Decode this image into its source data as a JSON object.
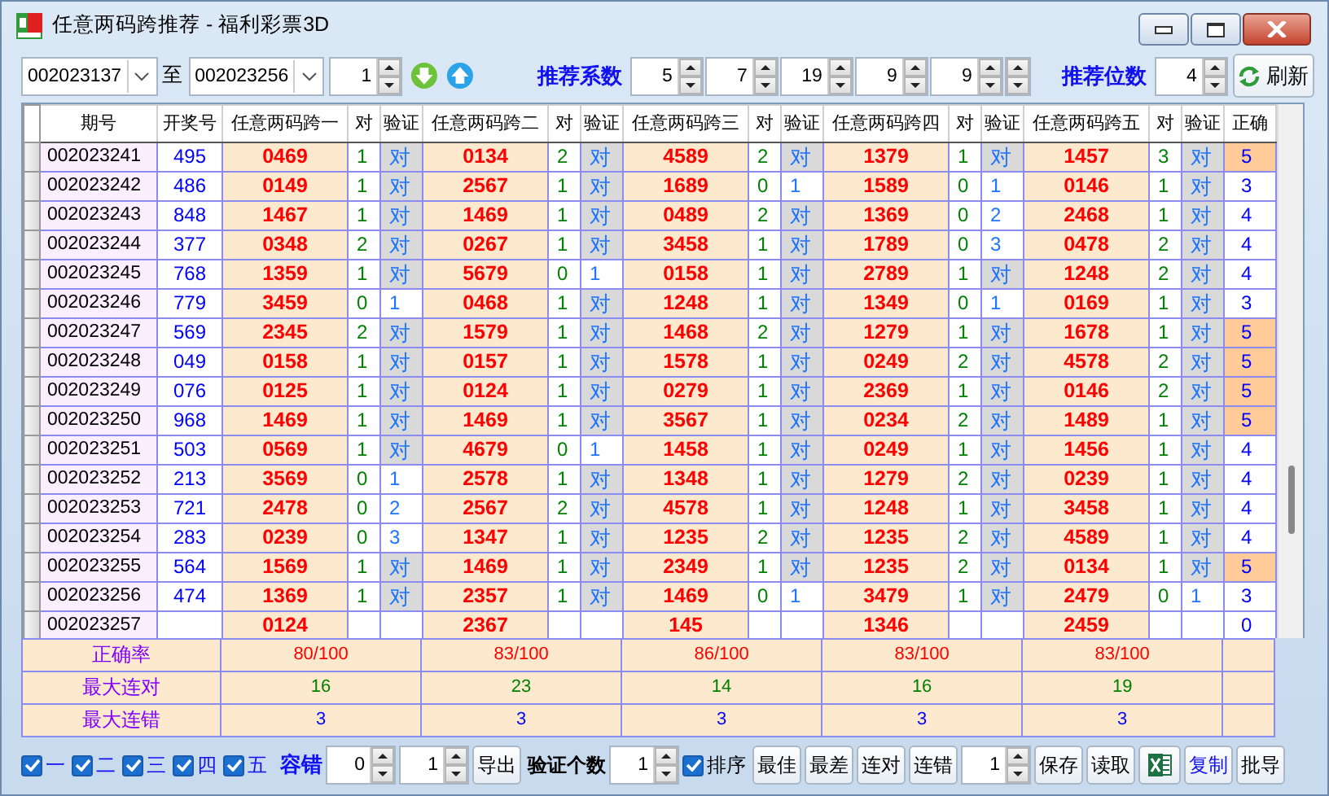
{
  "window": {
    "title": "任意两码跨推荐 - 福利彩票3D"
  },
  "toolbar": {
    "from_period": "002023137",
    "to_label": "至",
    "to_period": "002023256",
    "step": "1",
    "coef_label": "推荐系数",
    "coefs": [
      "5",
      "7",
      "19",
      "9",
      "9"
    ],
    "digits_label": "推荐位数",
    "digits": "4",
    "refresh": "刷新"
  },
  "table": {
    "columns": [
      "期号",
      "开奖号",
      "任意两码跨一",
      "对",
      "验证",
      "任意两码跨二",
      "对",
      "验证",
      "任意两码跨三",
      "对",
      "验证",
      "任意两码跨四",
      "对",
      "验证",
      "任意两码跨五",
      "对",
      "验证",
      "正确"
    ],
    "rows": [
      {
        "period": "002023241",
        "draw": "495",
        "picks": [
          {
            "pick": "0469",
            "hits": "1",
            "check": "对",
            "verified": true
          },
          {
            "pick": "0134",
            "hits": "2",
            "check": "对",
            "verified": true
          },
          {
            "pick": "4589",
            "hits": "2",
            "check": "对",
            "verified": true
          },
          {
            "pick": "1379",
            "hits": "1",
            "check": "对",
            "verified": true
          },
          {
            "pick": "1457",
            "hits": "3",
            "check": "对",
            "verified": true
          }
        ],
        "correct": "5",
        "highlight": true
      },
      {
        "period": "002023242",
        "draw": "486",
        "picks": [
          {
            "pick": "0149",
            "hits": "1",
            "check": "对",
            "verified": true
          },
          {
            "pick": "2567",
            "hits": "1",
            "check": "对",
            "verified": true
          },
          {
            "pick": "1689",
            "hits": "0",
            "check": "1",
            "verified": false
          },
          {
            "pick": "1589",
            "hits": "0",
            "check": "1",
            "verified": false
          },
          {
            "pick": "0146",
            "hits": "1",
            "check": "对",
            "verified": true
          }
        ],
        "correct": "3",
        "highlight": false
      },
      {
        "period": "002023243",
        "draw": "848",
        "picks": [
          {
            "pick": "1467",
            "hits": "1",
            "check": "对",
            "verified": true
          },
          {
            "pick": "1469",
            "hits": "1",
            "check": "对",
            "verified": true
          },
          {
            "pick": "0489",
            "hits": "2",
            "check": "对",
            "verified": true
          },
          {
            "pick": "1369",
            "hits": "0",
            "check": "2",
            "verified": false
          },
          {
            "pick": "2468",
            "hits": "1",
            "check": "对",
            "verified": true
          }
        ],
        "correct": "4",
        "highlight": false
      },
      {
        "period": "002023244",
        "draw": "377",
        "picks": [
          {
            "pick": "0348",
            "hits": "2",
            "check": "对",
            "verified": true
          },
          {
            "pick": "0267",
            "hits": "1",
            "check": "对",
            "verified": true
          },
          {
            "pick": "3458",
            "hits": "1",
            "check": "对",
            "verified": true
          },
          {
            "pick": "1789",
            "hits": "0",
            "check": "3",
            "verified": false
          },
          {
            "pick": "0478",
            "hits": "2",
            "check": "对",
            "verified": true
          }
        ],
        "correct": "4",
        "highlight": false
      },
      {
        "period": "002023245",
        "draw": "768",
        "picks": [
          {
            "pick": "1359",
            "hits": "1",
            "check": "对",
            "verified": true
          },
          {
            "pick": "5679",
            "hits": "0",
            "check": "1",
            "verified": false
          },
          {
            "pick": "0158",
            "hits": "1",
            "check": "对",
            "verified": true
          },
          {
            "pick": "2789",
            "hits": "1",
            "check": "对",
            "verified": true
          },
          {
            "pick": "1248",
            "hits": "2",
            "check": "对",
            "verified": true
          }
        ],
        "correct": "4",
        "highlight": false
      },
      {
        "period": "002023246",
        "draw": "779",
        "picks": [
          {
            "pick": "3459",
            "hits": "0",
            "check": "1",
            "verified": false
          },
          {
            "pick": "0468",
            "hits": "1",
            "check": "对",
            "verified": true
          },
          {
            "pick": "1248",
            "hits": "1",
            "check": "对",
            "verified": true
          },
          {
            "pick": "1349",
            "hits": "0",
            "check": "1",
            "verified": false
          },
          {
            "pick": "0169",
            "hits": "1",
            "check": "对",
            "verified": true
          }
        ],
        "correct": "3",
        "highlight": false
      },
      {
        "period": "002023247",
        "draw": "569",
        "picks": [
          {
            "pick": "2345",
            "hits": "2",
            "check": "对",
            "verified": true
          },
          {
            "pick": "1579",
            "hits": "1",
            "check": "对",
            "verified": true
          },
          {
            "pick": "1468",
            "hits": "2",
            "check": "对",
            "verified": true
          },
          {
            "pick": "1279",
            "hits": "1",
            "check": "对",
            "verified": true
          },
          {
            "pick": "1678",
            "hits": "1",
            "check": "对",
            "verified": true
          }
        ],
        "correct": "5",
        "highlight": true
      },
      {
        "period": "002023248",
        "draw": "049",
        "picks": [
          {
            "pick": "0158",
            "hits": "1",
            "check": "对",
            "verified": true
          },
          {
            "pick": "0157",
            "hits": "1",
            "check": "对",
            "verified": true
          },
          {
            "pick": "1578",
            "hits": "1",
            "check": "对",
            "verified": true
          },
          {
            "pick": "0249",
            "hits": "2",
            "check": "对",
            "verified": true
          },
          {
            "pick": "4578",
            "hits": "2",
            "check": "对",
            "verified": true
          }
        ],
        "correct": "5",
        "highlight": true
      },
      {
        "period": "002023249",
        "draw": "076",
        "picks": [
          {
            "pick": "0125",
            "hits": "1",
            "check": "对",
            "verified": true
          },
          {
            "pick": "0124",
            "hits": "1",
            "check": "对",
            "verified": true
          },
          {
            "pick": "0279",
            "hits": "1",
            "check": "对",
            "verified": true
          },
          {
            "pick": "2369",
            "hits": "1",
            "check": "对",
            "verified": true
          },
          {
            "pick": "0146",
            "hits": "2",
            "check": "对",
            "verified": true
          }
        ],
        "correct": "5",
        "highlight": true
      },
      {
        "period": "002023250",
        "draw": "968",
        "picks": [
          {
            "pick": "1469",
            "hits": "1",
            "check": "对",
            "verified": true
          },
          {
            "pick": "1469",
            "hits": "1",
            "check": "对",
            "verified": true
          },
          {
            "pick": "3567",
            "hits": "1",
            "check": "对",
            "verified": true
          },
          {
            "pick": "0234",
            "hits": "2",
            "check": "对",
            "verified": true
          },
          {
            "pick": "1489",
            "hits": "1",
            "check": "对",
            "verified": true
          }
        ],
        "correct": "5",
        "highlight": true
      },
      {
        "period": "002023251",
        "draw": "503",
        "picks": [
          {
            "pick": "0569",
            "hits": "1",
            "check": "对",
            "verified": true
          },
          {
            "pick": "4679",
            "hits": "0",
            "check": "1",
            "verified": false
          },
          {
            "pick": "1458",
            "hits": "1",
            "check": "对",
            "verified": true
          },
          {
            "pick": "0249",
            "hits": "1",
            "check": "对",
            "verified": true
          },
          {
            "pick": "1456",
            "hits": "1",
            "check": "对",
            "verified": true
          }
        ],
        "correct": "4",
        "highlight": false
      },
      {
        "period": "002023252",
        "draw": "213",
        "picks": [
          {
            "pick": "3569",
            "hits": "0",
            "check": "1",
            "verified": false
          },
          {
            "pick": "2578",
            "hits": "1",
            "check": "对",
            "verified": true
          },
          {
            "pick": "1348",
            "hits": "1",
            "check": "对",
            "verified": true
          },
          {
            "pick": "1279",
            "hits": "2",
            "check": "对",
            "verified": true
          },
          {
            "pick": "0239",
            "hits": "1",
            "check": "对",
            "verified": true
          }
        ],
        "correct": "4",
        "highlight": false
      },
      {
        "period": "002023253",
        "draw": "721",
        "picks": [
          {
            "pick": "2478",
            "hits": "0",
            "check": "2",
            "verified": false
          },
          {
            "pick": "2567",
            "hits": "2",
            "check": "对",
            "verified": true
          },
          {
            "pick": "4578",
            "hits": "1",
            "check": "对",
            "verified": true
          },
          {
            "pick": "1248",
            "hits": "1",
            "check": "对",
            "verified": true
          },
          {
            "pick": "3458",
            "hits": "1",
            "check": "对",
            "verified": true
          }
        ],
        "correct": "4",
        "highlight": false
      },
      {
        "period": "002023254",
        "draw": "283",
        "picks": [
          {
            "pick": "0239",
            "hits": "0",
            "check": "3",
            "verified": false
          },
          {
            "pick": "1347",
            "hits": "1",
            "check": "对",
            "verified": true
          },
          {
            "pick": "1235",
            "hits": "2",
            "check": "对",
            "verified": true
          },
          {
            "pick": "1235",
            "hits": "2",
            "check": "对",
            "verified": true
          },
          {
            "pick": "4589",
            "hits": "1",
            "check": "对",
            "verified": true
          }
        ],
        "correct": "4",
        "highlight": false
      },
      {
        "period": "002023255",
        "draw": "564",
        "picks": [
          {
            "pick": "1569",
            "hits": "1",
            "check": "对",
            "verified": true
          },
          {
            "pick": "1469",
            "hits": "1",
            "check": "对",
            "verified": true
          },
          {
            "pick": "2349",
            "hits": "1",
            "check": "对",
            "verified": true
          },
          {
            "pick": "1235",
            "hits": "2",
            "check": "对",
            "verified": true
          },
          {
            "pick": "0134",
            "hits": "1",
            "check": "对",
            "verified": true
          }
        ],
        "correct": "5",
        "highlight": true
      },
      {
        "period": "002023256",
        "draw": "474",
        "picks": [
          {
            "pick": "1369",
            "hits": "1",
            "check": "对",
            "verified": true
          },
          {
            "pick": "2357",
            "hits": "1",
            "check": "对",
            "verified": true
          },
          {
            "pick": "1469",
            "hits": "0",
            "check": "1",
            "verified": false
          },
          {
            "pick": "3479",
            "hits": "1",
            "check": "对",
            "verified": true
          },
          {
            "pick": "2479",
            "hits": "0",
            "check": "1",
            "verified": false
          }
        ],
        "correct": "3",
        "highlight": false
      },
      {
        "period": "002023257",
        "picks": [
          {
            "pick": "0124"
          },
          {
            "pick": "2367"
          },
          {
            "pick": "145"
          },
          {
            "pick": "1346"
          },
          {
            "pick": "2459"
          }
        ],
        "correct": "0",
        "highlight": false
      }
    ],
    "summary": [
      {
        "label": "正确率",
        "kind": "rate",
        "values": [
          "80/100",
          "83/100",
          "86/100",
          "83/100",
          "83/100"
        ]
      },
      {
        "label": "最大连对",
        "kind": "streak_right",
        "values": [
          "16",
          "23",
          "14",
          "16",
          "19"
        ]
      },
      {
        "label": "最大连错",
        "kind": "streak_wrong",
        "values": [
          "3",
          "3",
          "3",
          "3",
          "3"
        ]
      }
    ]
  },
  "bottom": {
    "positions": [
      {
        "label": "一",
        "checked": true
      },
      {
        "label": "二",
        "checked": true
      },
      {
        "label": "三",
        "checked": true
      },
      {
        "label": "四",
        "checked": true
      },
      {
        "label": "五",
        "checked": true
      }
    ],
    "tolerance_label": "容错",
    "tolerance": [
      "0",
      "1"
    ],
    "export": "导出",
    "verify_label": "验证个数",
    "verify_count": "1",
    "sort": {
      "label": "排序",
      "checked": true
    },
    "filters": [
      "最佳",
      "最差",
      "连对",
      "连错"
    ],
    "count": "1",
    "save": "保存",
    "load": "读取",
    "copy": "复制",
    "batch": "批导"
  }
}
